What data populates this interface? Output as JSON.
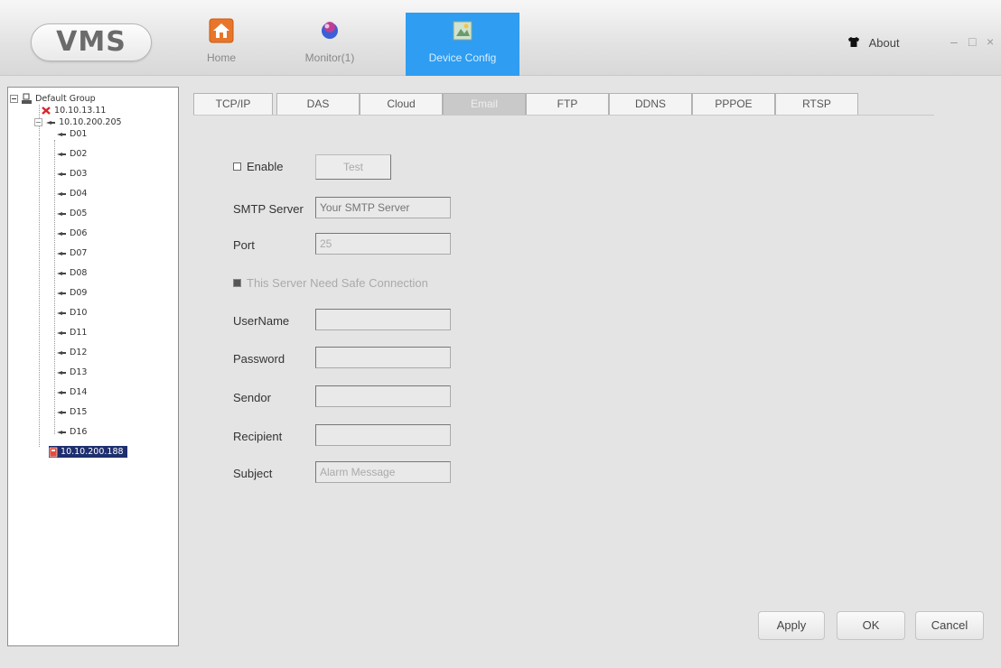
{
  "app": {
    "logo": "VMS",
    "nav": [
      {
        "label": "Home",
        "icon": "home-icon"
      },
      {
        "label": "Monitor(1)",
        "icon": "monitor-icon"
      },
      {
        "label": "Device Config",
        "icon": "device-config-icon"
      }
    ],
    "about_label": "About",
    "window_controls": {
      "minimize": "–",
      "maximize": "□",
      "close": "×"
    }
  },
  "tree": {
    "root": "Default Group",
    "nodes": [
      {
        "label": "10.10.13.11",
        "status": "offline"
      },
      {
        "label": "10.10.200.205",
        "status": "online",
        "channels": [
          "D01",
          "D02",
          "D03",
          "D04",
          "D05",
          "D06",
          "D07",
          "D08",
          "D09",
          "D10",
          "D11",
          "D12",
          "D13",
          "D14",
          "D15",
          "D16"
        ]
      },
      {
        "label": "10.10.200.188",
        "status": "selected"
      }
    ]
  },
  "tabs": [
    "TCP/IP",
    "DAS",
    "Cloud",
    "Email",
    "FTP",
    "DDNS",
    "PPPOE",
    "RTSP"
  ],
  "active_tab": "Email",
  "email_form": {
    "enable_label": "Enable",
    "enable_checked": false,
    "test_label": "Test",
    "smtp_server_label": "SMTP Server",
    "smtp_server_placeholder": "Your SMTP Server",
    "port_label": "Port",
    "port_value": "25",
    "safe_connection_label": "This Server Need Safe Connection",
    "username_label": "UserName",
    "username_value": "",
    "password_label": "Password",
    "password_value": "",
    "sendor_label": "Sendor",
    "sendor_value": "",
    "recipient_label": "Recipient",
    "recipient_value": "",
    "subject_label": "Subject",
    "subject_value": "Alarm Message"
  },
  "buttons": {
    "apply": "Apply",
    "ok": "OK",
    "cancel": "Cancel"
  },
  "colors": {
    "accent": "#2e9df2",
    "selection": "#1e2e6e",
    "offline": "#d9262a"
  }
}
